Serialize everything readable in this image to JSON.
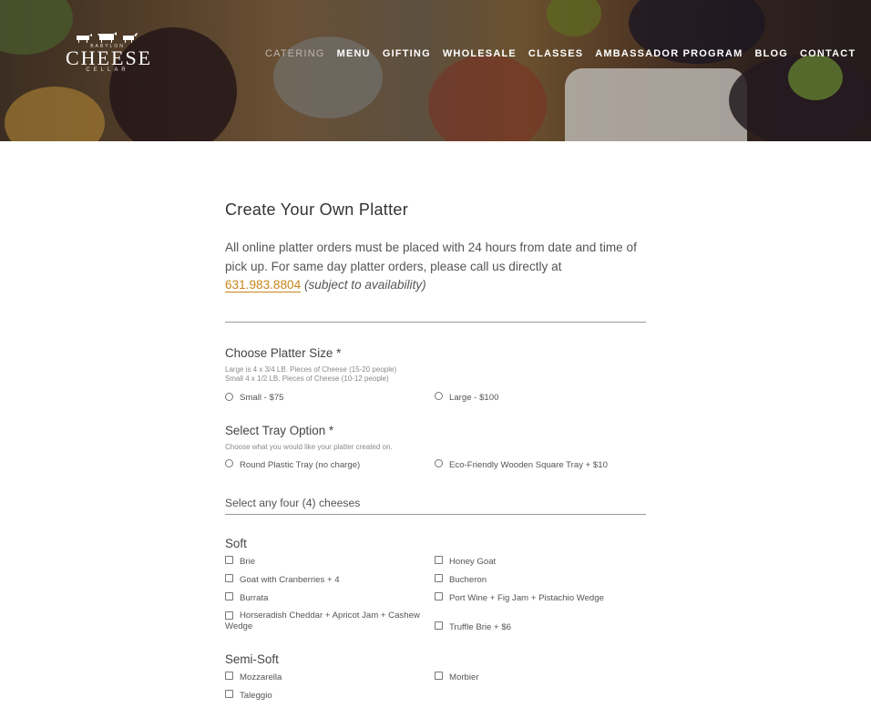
{
  "brand": {
    "top_word": "BABYLON",
    "main_word": "CHEESE",
    "bottom_word": "CELLAR"
  },
  "nav": {
    "items": [
      "CATERING",
      "MENU",
      "GIFTING",
      "WHOLESALE",
      "CLASSES",
      "AMBASSADOR PROGRAM",
      "BLOG",
      "CONTACT"
    ],
    "active": "CATERING"
  },
  "page": {
    "title": "Create Your Own Platter",
    "intro_text": "All online platter orders must be placed with 24 hours from date and time of pick up. For same day platter orders, please call us directly at",
    "phone": "631.983.8804",
    "availability": "(subject to availability)"
  },
  "platter_size": {
    "title": "Choose Platter Size *",
    "desc_line1": "Large is 4 x 3/4 LB. Pieces of Cheese (15-20 people)",
    "desc_line2": "Small 4 x 1/2 LB. Pieces of Cheese (10-12 people)",
    "options": [
      "Small - $75",
      "Large - $100"
    ]
  },
  "tray": {
    "title": "Select Tray Option *",
    "desc": "Choose what you would like your platter created on.",
    "options": [
      "Round Plastic Tray (no charge)",
      "Eco-Friendly Wooden Square Tray + $10"
    ]
  },
  "cheeses": {
    "section_title": "Select any four (4) cheeses",
    "soft": {
      "title": "Soft",
      "left": [
        "Brie",
        "Goat with Cranberries + 4",
        "Burrata",
        "Horseradish Cheddar + Apricot Jam + Cashew Wedge"
      ],
      "right": [
        "Honey Goat",
        "Bucheron",
        "Port Wine + Fig Jam + Pistachio Wedge",
        "Truffle Brie + $6"
      ]
    },
    "semi_soft": {
      "title": "Semi-Soft",
      "left": [
        "Mozzarella",
        "Taleggio"
      ],
      "right": [
        "Morbier"
      ]
    }
  },
  "colors": {
    "accent": "#c8851b",
    "text": "#444444",
    "rule": "#999999"
  }
}
